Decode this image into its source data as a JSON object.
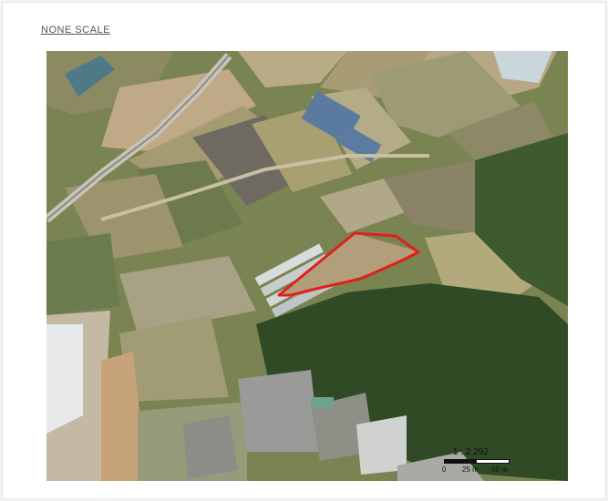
{
  "header": {
    "scale_note": "NONE SCALE"
  },
  "map": {
    "type": "aerial-satellite",
    "highlight": {
      "shape": "parcel-outline",
      "color": "#e0201c"
    },
    "scale": {
      "ratio": "1 : 2,292",
      "ticks": [
        "0",
        "25 m",
        "50 m"
      ]
    }
  }
}
